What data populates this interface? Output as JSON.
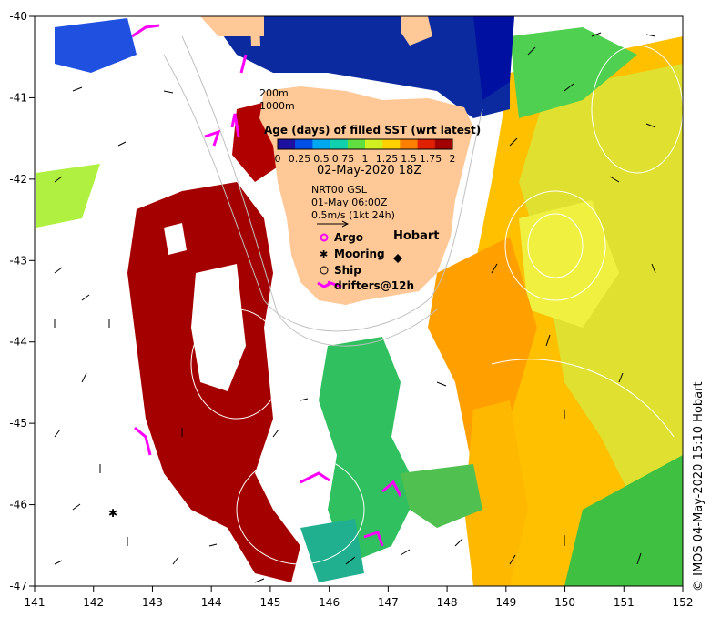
{
  "map": {
    "x_ticks": [
      "141",
      "142",
      "143",
      "144",
      "145",
      "146",
      "147",
      "148",
      "149",
      "150",
      "151",
      "152"
    ],
    "y_ticks": [
      "-40",
      "-41",
      "-42",
      "-43",
      "-44",
      "-45",
      "-46",
      "-47"
    ],
    "isobath_labels": [
      "200m",
      "1000m"
    ],
    "colorbar_title": "Age (days) of filled SST (wrt latest)",
    "colorbar_ticks": [
      "0",
      "0.25",
      "0.5",
      "0.75",
      "1",
      "1.25",
      "1.5",
      "1.75",
      "2"
    ],
    "colorbar_colors": [
      "#1e10a0",
      "#0050e8",
      "#00a8f0",
      "#10d0b0",
      "#60e040",
      "#d0f020",
      "#ffd000",
      "#ff8000",
      "#e02000",
      "#a00000"
    ],
    "date_label": "02-May-2020 18Z",
    "current_source": "NRT00 GSL",
    "current_time": "01-May 06:00Z",
    "vector_scale_label": "0.5m/s (1kt 24h)",
    "place_label": "Hobart",
    "symbol_legend": [
      {
        "label": "Argo",
        "symbol": "circle-magenta"
      },
      {
        "label": "Mooring",
        "symbol": "star"
      },
      {
        "label": "Ship",
        "symbol": "circle-open"
      },
      {
        "label": "drifters@12h",
        "symbol": "magenta-track"
      }
    ],
    "credit": "© IMOS 04-May-2020 15:10 Hobart",
    "colors": {
      "land": "#ffc896",
      "filled_old": "#a40000",
      "filled_green": "#30c060",
      "filled_orange": "#ffb400",
      "filled_yellow": "#e8e830",
      "deep_blue": "#0b2aa0",
      "drifter": "#ff00ff"
    }
  }
}
